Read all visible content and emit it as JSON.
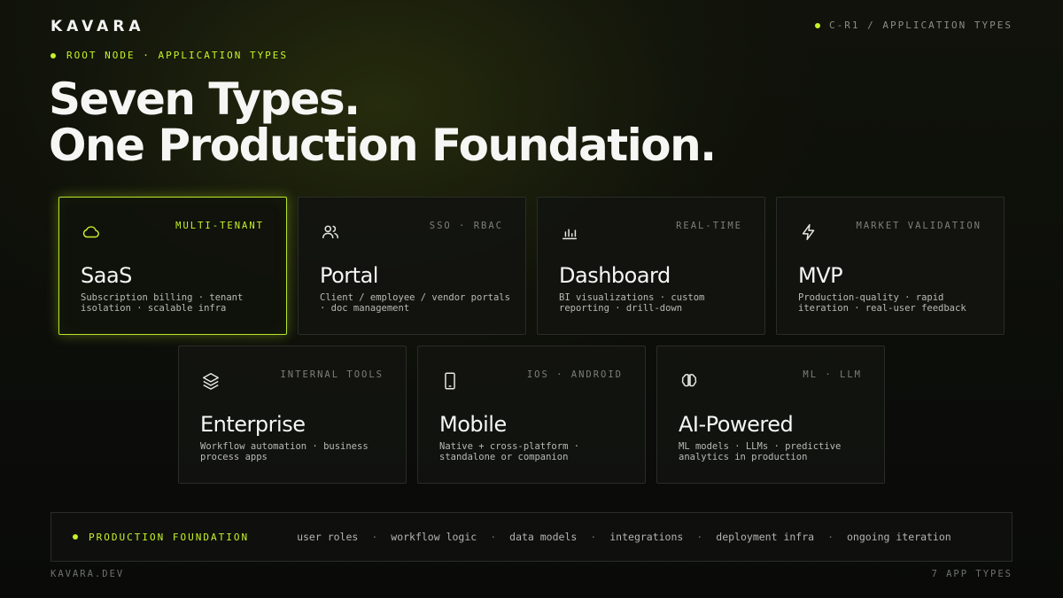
{
  "header": {
    "logo": "KAVARA",
    "section_tag": "C-R1 / APPLICATION TYPES",
    "eyebrow": "ROOT NODE · APPLICATION TYPES",
    "headline_line1": "Seven Types.",
    "headline_line2": "One Production Foundation."
  },
  "cards": [
    {
      "title": "SaaS",
      "tag": "MULTI-TENANT",
      "desc": "Subscription billing · tenant isolation · scalable infra",
      "icon": "cloud-icon"
    },
    {
      "title": "Portal",
      "tag": "SSO · RBAC",
      "desc": "Client / employee / vendor portals · doc management",
      "icon": "users-icon"
    },
    {
      "title": "Dashboard",
      "tag": "REAL-TIME",
      "desc": "BI visualizations · custom reporting · drill-down",
      "icon": "bar-chart-icon"
    },
    {
      "title": "MVP",
      "tag": "MARKET VALIDATION",
      "desc": "Production-quality · rapid iteration · real-user feedback",
      "icon": "lightning-icon"
    },
    {
      "title": "Enterprise",
      "tag": "INTERNAL TOOLS",
      "desc": "Workflow automation · business process apps",
      "icon": "layers-icon"
    },
    {
      "title": "Mobile",
      "tag": "IOS · ANDROID",
      "desc": "Native + cross-platform · standalone or companion",
      "icon": "smartphone-icon"
    },
    {
      "title": "AI-Powered",
      "tag": "ML · LLM",
      "desc": "ML models · LLMs · predictive analytics in production",
      "icon": "brain-icon"
    }
  ],
  "foundation": {
    "label": "PRODUCTION FOUNDATION",
    "items": [
      "user roles",
      "workflow logic",
      "data models",
      "integrations",
      "deployment infra",
      "ongoing iteration"
    ]
  },
  "footer": {
    "domain": "KAVARA.DEV",
    "count": "7 APP TYPES"
  },
  "colors": {
    "accent": "#c6f229",
    "background": "#0b0c09",
    "card_border": "#2a2c27"
  }
}
